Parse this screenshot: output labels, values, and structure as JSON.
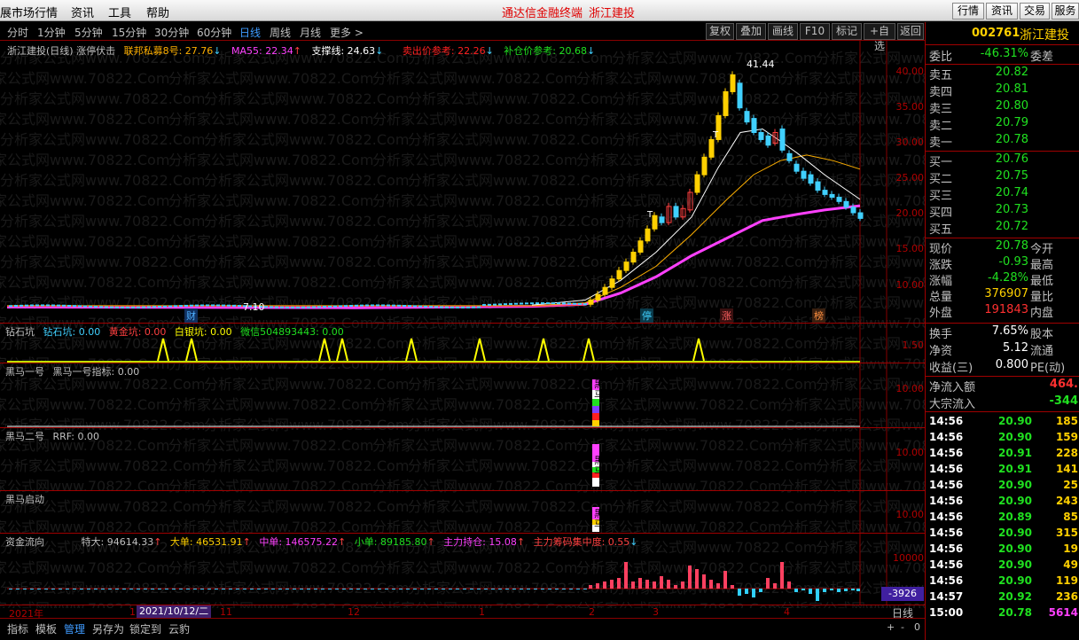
{
  "menubar": {
    "items": [
      "展市场行情",
      "资讯",
      "工具",
      "帮助"
    ],
    "center": [
      "通达信金融终端",
      "浙江建投"
    ],
    "right_buttons": [
      "行情",
      "资讯",
      "交易",
      "服务"
    ]
  },
  "period_bar": {
    "periods": [
      "分时",
      "1分钟",
      "5分钟",
      "15分钟",
      "30分钟",
      "60分钟",
      "日线",
      "周线",
      "月线",
      "更多 >"
    ],
    "active": "日线",
    "tools": [
      "复权",
      "叠加",
      "画线",
      "F10",
      "标记",
      "+自选",
      "返回"
    ]
  },
  "main_legend": {
    "title": "浙江建投(日线) 涨停伏击",
    "items": [
      {
        "label": "联邦私募8号: 27.76",
        "color": "#ffb000"
      },
      {
        "label": "MA55: 22.34",
        "color": "#ff40ff"
      },
      {
        "label": "支撑线: 24.63",
        "color": "#ffffff"
      },
      {
        "label": "卖出价参考: 22.26",
        "color": "#ff2020"
      },
      {
        "label": "补仓价参考: 20.68",
        "color": "#20e020"
      }
    ]
  },
  "main_chart": {
    "y_ticks": [
      "40.00",
      "35.00",
      "30.00",
      "25.00",
      "20.00",
      "15.00",
      "10.00"
    ],
    "high_label": "41.44",
    "low_label": "7.10",
    "markers": [
      {
        "text": "财",
        "color": "#4fb0ff"
      },
      {
        "text": "停",
        "color": "#40d0ff"
      },
      {
        "text": "涨",
        "color": "#ff6060"
      },
      {
        "text": "榜",
        "color": "#ff9040"
      }
    ],
    "t_labels": [
      "T",
      "T"
    ]
  },
  "panel1": {
    "title": "钻石坑",
    "items": [
      {
        "label": "钻石坑: 0.00",
        "color": "#40d0ff"
      },
      {
        "label": "黄金坑: 0.00",
        "color": "#ff4040"
      },
      {
        "label": "白银坑: 0.00",
        "color": "#ffff00"
      },
      {
        "label": "微信504893443: 0.00",
        "color": "#20e020"
      }
    ],
    "y_ticks": [
      "1.50"
    ]
  },
  "panel2": {
    "title": "黑马一号",
    "items": [
      {
        "label": "黑马一号指标: 0.00",
        "color": "#c0c0c0"
      }
    ],
    "y_ticks": [
      "10.00"
    ],
    "bar_text": [
      "黑",
      "马"
    ]
  },
  "panel3": {
    "title": "黑马二号",
    "items": [
      {
        "label": "RRF: 0.00",
        "color": "#c0c0c0"
      }
    ],
    "y_ticks": [
      "10.00"
    ],
    "bar_text": [
      "黑",
      "马"
    ]
  },
  "panel4": {
    "title": "黑马启动",
    "items": [],
    "y_ticks": [
      "10.00"
    ],
    "bar_text": [
      "黑",
      "马"
    ]
  },
  "panel5": {
    "title": "资金流向",
    "items": [
      {
        "label": "特大: 94614.33",
        "color": "#c0c0c0"
      },
      {
        "label": "大单: 46531.91",
        "color": "#ffd000"
      },
      {
        "label": "中单: 146575.22",
        "color": "#ff40ff"
      },
      {
        "label": "小单: 89185.80",
        "color": "#20e020"
      },
      {
        "label": "主力持仓: 15.08",
        "color": "#ff40ff"
      },
      {
        "label": "主力筹码集中度: 0.55",
        "color": "#ff4040"
      }
    ],
    "y_ticks": [
      "10000"
    ],
    "readout": "-3926"
  },
  "time_axis": {
    "labels": [
      "2021年",
      "1",
      "10",
      "11",
      "12",
      "1",
      "2",
      "3",
      "4"
    ],
    "cursor_date": "2021/10/12/二",
    "period": "日线"
  },
  "bottom_bar": {
    "items": [
      "指标",
      "模板",
      "管理",
      "另存为",
      "锁定到",
      "云豹"
    ],
    "active": "管理",
    "controls": [
      "+",
      "-",
      "0"
    ]
  },
  "watermark": "分析家公式网www.70822.Com",
  "right_panel": {
    "code": "002761",
    "name": "浙江建投",
    "weibi": {
      "label": "委比",
      "value": "-46.31%",
      "right": "委差"
    },
    "asks": [
      {
        "label": "卖五",
        "price": "20.82"
      },
      {
        "label": "卖四",
        "price": "20.81"
      },
      {
        "label": "卖三",
        "price": "20.80"
      },
      {
        "label": "卖二",
        "price": "20.79"
      },
      {
        "label": "卖一",
        "price": "20.78"
      }
    ],
    "bids": [
      {
        "label": "买一",
        "price": "20.76"
      },
      {
        "label": "买二",
        "price": "20.75"
      },
      {
        "label": "买三",
        "price": "20.74"
      },
      {
        "label": "买四",
        "price": "20.73"
      },
      {
        "label": "买五",
        "price": "20.72"
      }
    ],
    "quote": [
      {
        "label": "现价",
        "value": "20.78",
        "right": "今开",
        "color": "#20e020"
      },
      {
        "label": "涨跌",
        "value": "-0.93",
        "right": "最高",
        "color": "#20e020"
      },
      {
        "label": "涨幅",
        "value": "-4.28%",
        "right": "最低",
        "color": "#20e020"
      },
      {
        "label": "总量",
        "value": "376907",
        "right": "量比",
        "color": "#ffd000"
      },
      {
        "label": "外盘",
        "value": "191843",
        "right": "内盘",
        "color": "#ff3030"
      }
    ],
    "stats": [
      {
        "label": "换手",
        "value": "7.65%",
        "right": "股本",
        "color": "#ffffff"
      },
      {
        "label": "净资",
        "value": "5.12",
        "right": "流通",
        "color": "#ffffff"
      },
      {
        "label": "收益(三)",
        "value": "0.800",
        "right": "PE(动)",
        "color": "#ffffff"
      }
    ],
    "flows": [
      {
        "label": "净流入额",
        "value": "464.",
        "color": "#ff3030"
      },
      {
        "label": "大宗流入",
        "value": "-344",
        "color": "#20e020"
      }
    ],
    "ticks": [
      {
        "time": "14:56",
        "price": "20.90",
        "vol": "185"
      },
      {
        "time": "14:56",
        "price": "20.90",
        "vol": "159"
      },
      {
        "time": "14:56",
        "price": "20.91",
        "vol": "228"
      },
      {
        "time": "14:56",
        "price": "20.91",
        "vol": "141"
      },
      {
        "time": "14:56",
        "price": "20.90",
        "vol": "25"
      },
      {
        "time": "14:56",
        "price": "20.90",
        "vol": "243"
      },
      {
        "time": "14:56",
        "price": "20.89",
        "vol": "85"
      },
      {
        "time": "14:56",
        "price": "20.90",
        "vol": "315"
      },
      {
        "time": "14:56",
        "price": "20.90",
        "vol": "19"
      },
      {
        "time": "14:56",
        "price": "20.90",
        "vol": "49"
      },
      {
        "time": "14:56",
        "price": "20.90",
        "vol": "119"
      },
      {
        "time": "14:57",
        "price": "20.92",
        "vol": "236"
      },
      {
        "time": "15:00",
        "price": "20.78",
        "vol": "5614"
      }
    ]
  }
}
